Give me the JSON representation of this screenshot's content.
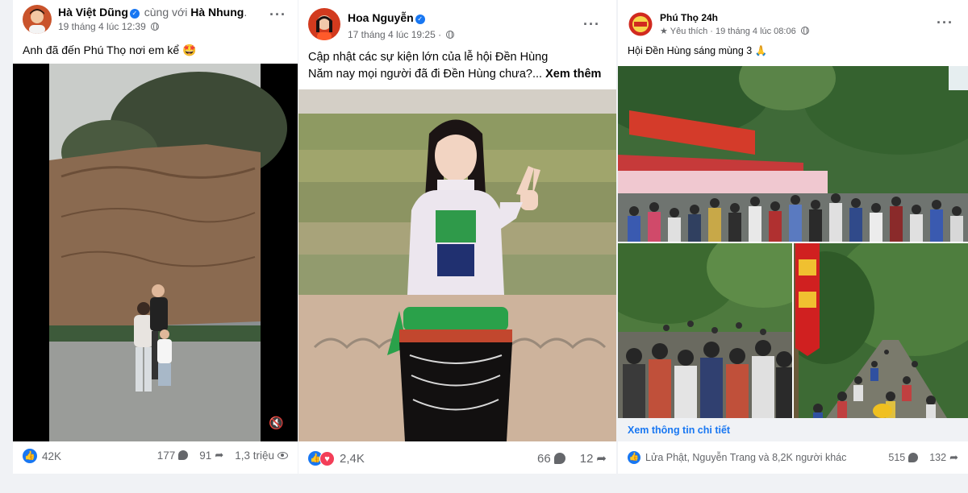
{
  "posts": [
    {
      "author": "Hà Việt Dũng",
      "with_text": "cùng với",
      "tagged": "Hà Nhung",
      "tagged_suffix": ".",
      "timestamp": "19 tháng 4 lúc 12:39",
      "caption": "Anh đã đến Phú Thọ nơi em kể 🤩",
      "reactions_count": "42K",
      "comments_count": "177",
      "shares_count": "91",
      "views_count": "1,3 triệu"
    },
    {
      "author": "Hoa Nguyễn",
      "timestamp": "17 tháng 4 lúc 19:25",
      "caption_line1": "Cập nhật các sự kiện lớn của lễ hội Đền Hùng",
      "caption_line2": "Năm nay mọi người đã đi Đền Hùng chưa?...",
      "see_more": "Xem thêm",
      "reactions_count": "2,4K",
      "comments_count": "66",
      "shares_count": "12"
    },
    {
      "author": "Phú Thọ 24h",
      "favorite_label": "Yêu thích",
      "timestamp": "19 tháng 4 lúc 08:06",
      "caption": "Hội Đền Hùng sáng mùng 3 🙏",
      "link_label": "Xem thông tin chi tiết",
      "reactions_text": "Lửa Phật, Nguyễn Trang và 8,2K người khác",
      "comments_count": "515",
      "shares_count": "132"
    }
  ],
  "icons": {
    "more": "more-dots-icon",
    "privacy": "globe-icon",
    "verified": "verified-badge-icon",
    "like": "like-icon",
    "love": "love-icon",
    "comment": "comment-icon",
    "share": "share-icon",
    "views": "eye-icon",
    "mute": "speaker-muted-icon"
  },
  "colors": {
    "accent": "#1877f2",
    "love": "#f33e58",
    "muted_text": "#65676b",
    "page_bg": "#f0f2f5"
  }
}
